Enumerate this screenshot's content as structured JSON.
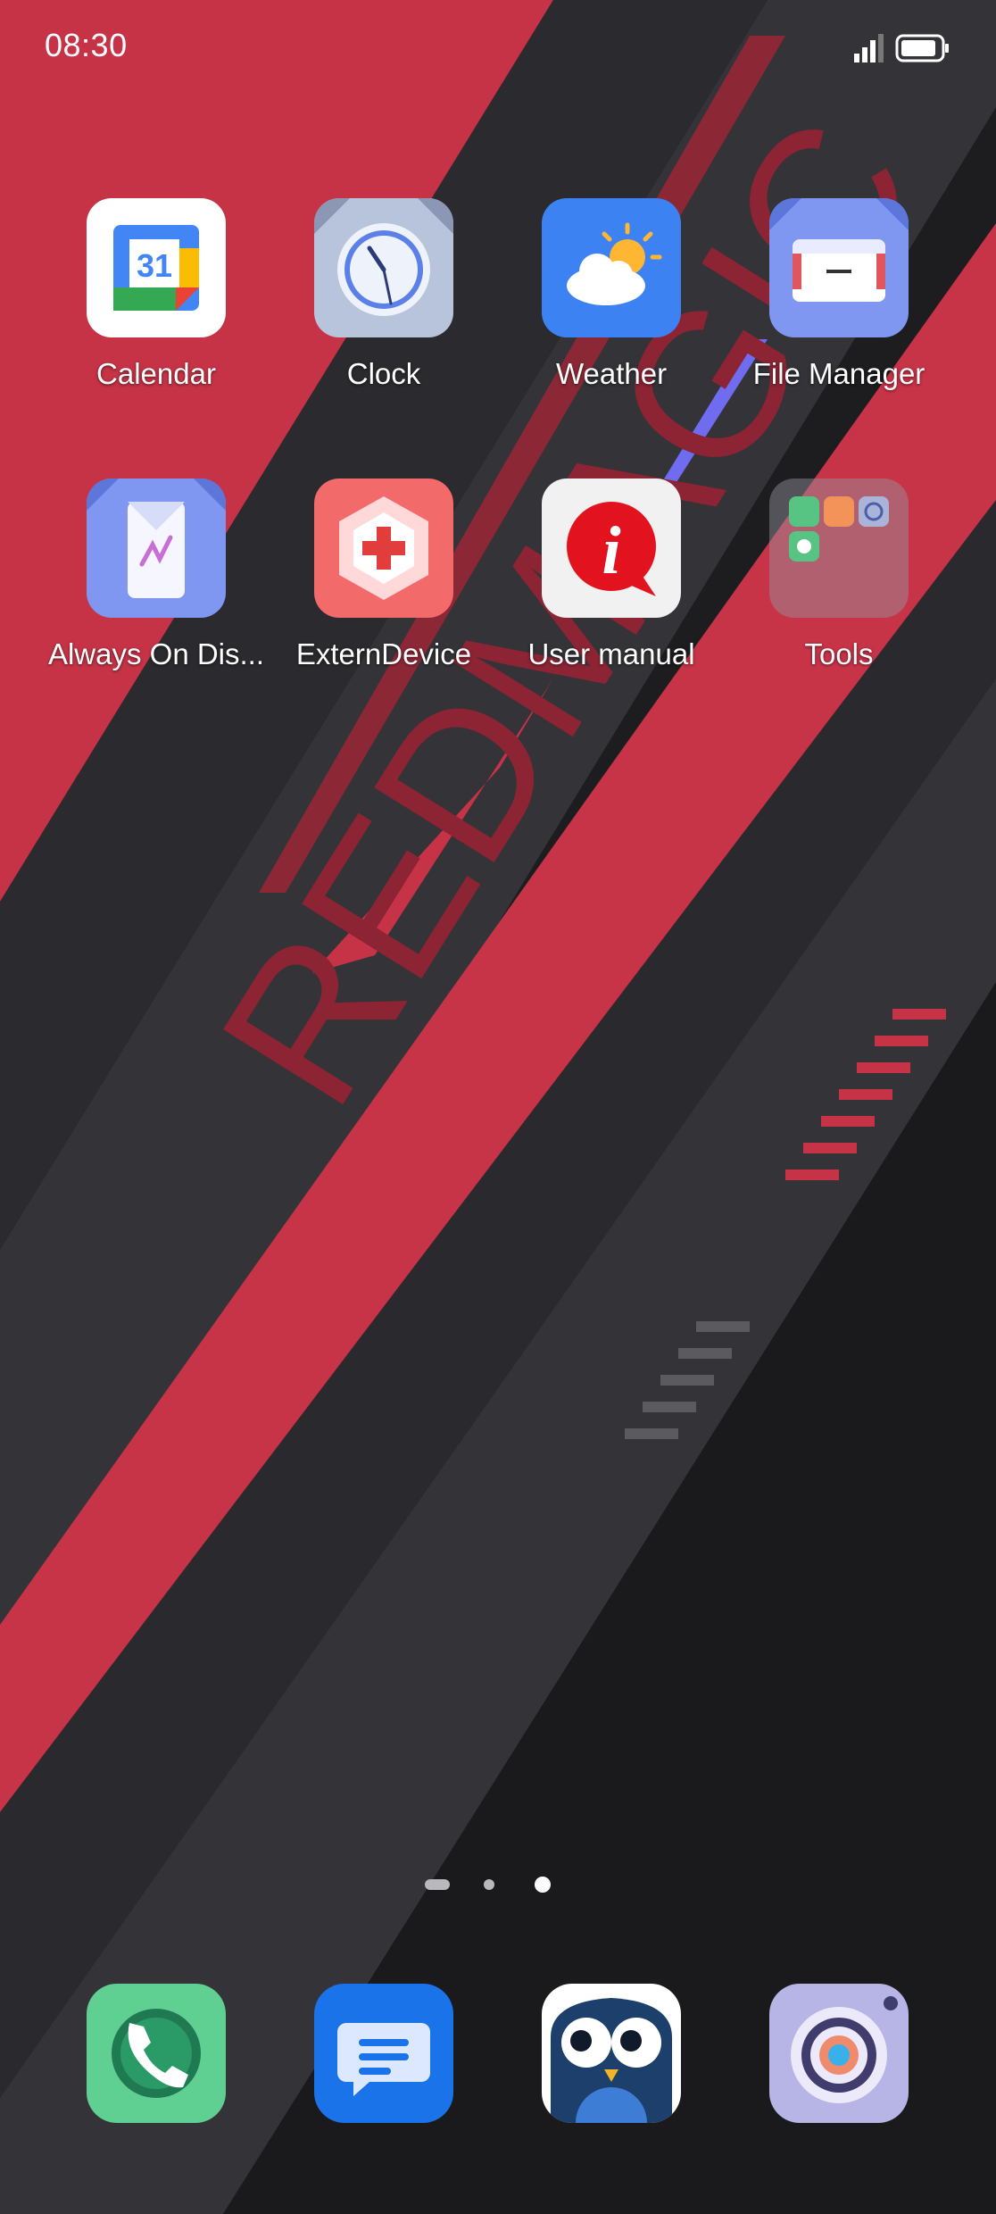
{
  "status_bar": {
    "time": "08:30"
  },
  "apps": [
    {
      "label": "Calendar",
      "icon": "calendar-icon",
      "badge": "31"
    },
    {
      "label": "Clock",
      "icon": "clock-icon"
    },
    {
      "label": "Weather",
      "icon": "weather-icon"
    },
    {
      "label": "File Manager",
      "icon": "file-manager-icon"
    },
    {
      "label": "Always On Dis...",
      "icon": "always-on-display-icon"
    },
    {
      "label": "ExternDevice",
      "icon": "externdevice-icon"
    },
    {
      "label": "User manual",
      "icon": "user-manual-icon"
    },
    {
      "label": "Tools",
      "icon": "tools-folder-icon"
    }
  ],
  "page_indicator": {
    "pages": 3,
    "current": 3
  },
  "dock": [
    {
      "icon": "phone-icon"
    },
    {
      "icon": "messages-icon"
    },
    {
      "icon": "owl-app-icon"
    },
    {
      "icon": "camera-icon"
    }
  ],
  "colors": {
    "accent_red": "#c93547",
    "dark": "#1e1e21"
  }
}
